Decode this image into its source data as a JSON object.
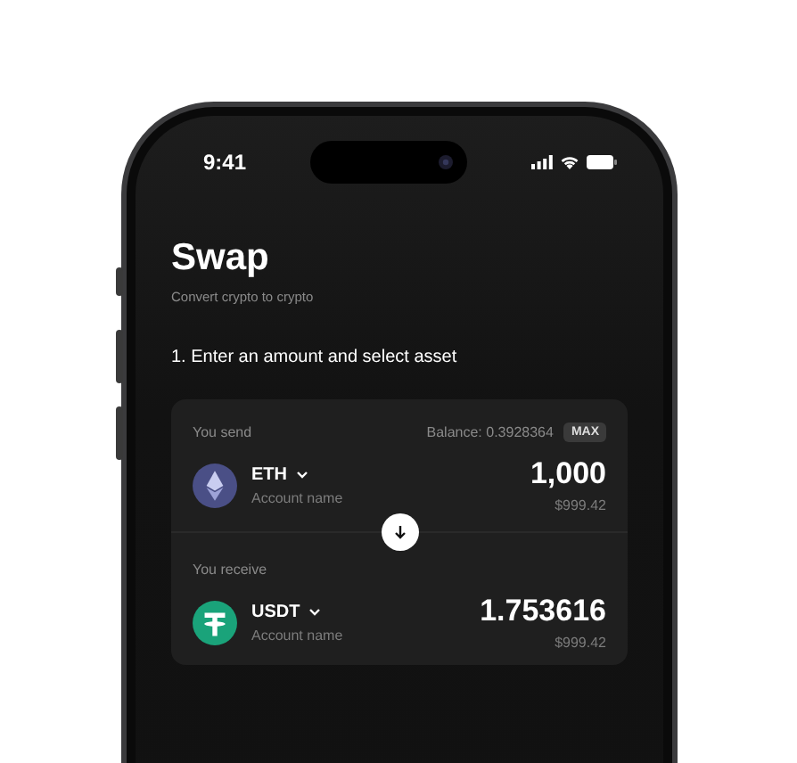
{
  "status_bar": {
    "time": "9:41"
  },
  "header": {
    "title": "Swap",
    "subtitle": "Convert crypto to crypto"
  },
  "step": "1. Enter an amount and select asset",
  "swap_card": {
    "sections": [
      {
        "label": "You send",
        "balance": "Balance: 0.3928364",
        "max_button": "MAX",
        "asset": {
          "kind": "eth",
          "symbol": "ETH",
          "account": "Account name",
          "amount": "1,000",
          "fiat": "$999.42"
        }
      },
      {
        "label": "You receive",
        "asset": {
          "kind": "usdt",
          "symbol": "USDT",
          "account": "Account name",
          "amount": "1.753616",
          "fiat": "$999.42"
        }
      }
    ]
  }
}
